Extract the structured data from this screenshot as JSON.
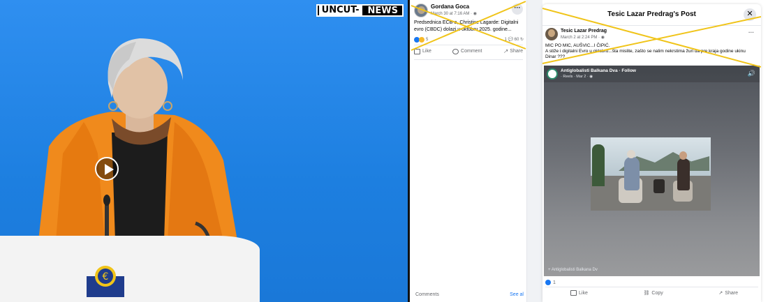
{
  "video": {
    "logo_left": "UNCUT-",
    "logo_right": "NEWS",
    "emblem_symbol": "€"
  },
  "feed_post": {
    "author": "Gordana Goca",
    "time": "March 30 at 7:16 AM · ",
    "text": "Predsednica ECB-a, Christine Lagarde: Digitalni evro (CBDC) dolazi u oktobru 2025. godine...",
    "reactions": "5",
    "counts": "1 💬 60 ↻",
    "more": "···",
    "actions": {
      "like": "Like",
      "comment": "Comment",
      "share": "Share"
    },
    "comments_label": "Comments",
    "see_all": "See al"
  },
  "modal": {
    "title": "Tesic Lazar Predrag's Post",
    "close": "✕",
    "author": "Tesic Lazar Predrag",
    "time": "March 2 at 2:24 PM · ",
    "more": "···",
    "text_line1": "MIC PO MIC, AUŠVIC...I ČIPIĆ.",
    "text_line2": "A stiže i digitalni Evro u oktobru...šta mislite, zašto se nalim nekrstima žuri da pre kraja godine ukinu Dinar ???",
    "reel": {
      "page_name": "Antiglobalisti Balkana Dva · Follow",
      "sub": "· Reels · Mar 2 · ",
      "volume": "🔊",
      "footer": "+   Antiglobalisti Balkana Dv"
    },
    "reaction_count": "1",
    "actions": {
      "like": "Like",
      "copy": "Copy",
      "share": "Share"
    }
  },
  "colors": {
    "fb_blue": "#1877f2",
    "cross_yellow": "#f0c419",
    "video_blue": "#1f86e8",
    "jacket_orange": "#f08a1c"
  }
}
